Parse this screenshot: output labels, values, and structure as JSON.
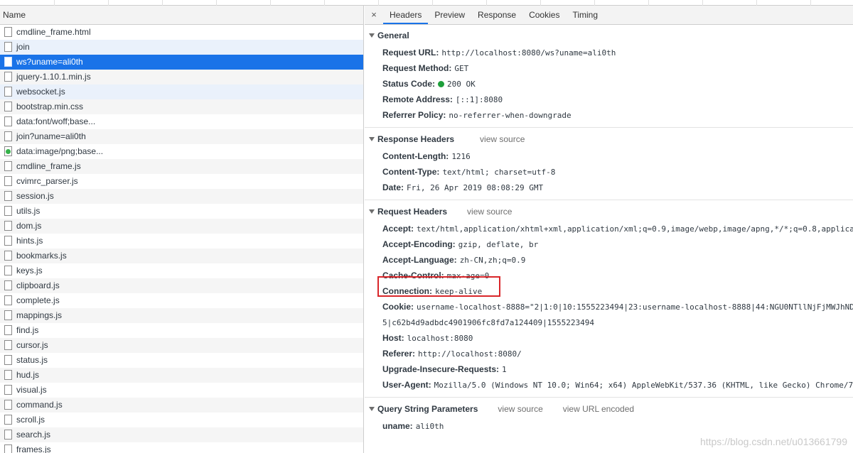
{
  "left": {
    "header": "Name",
    "rows": [
      {
        "label": "cmdline_frame.html",
        "state": "normal",
        "icon": "file-icon"
      },
      {
        "label": "join",
        "state": "hover",
        "icon": "file-icon"
      },
      {
        "label": "ws?uname=ali0th",
        "state": "selected",
        "icon": "file-icon"
      },
      {
        "label": "jquery-1.10.1.min.js",
        "state": "normal",
        "icon": "file-icon"
      },
      {
        "label": "websocket.js",
        "state": "hover",
        "icon": "file-icon"
      },
      {
        "label": "bootstrap.min.css",
        "state": "normal",
        "icon": "file-icon"
      },
      {
        "label": "data:font/woff;base...",
        "state": "normal",
        "icon": "file-icon"
      },
      {
        "label": "join?uname=ali0th",
        "state": "normal",
        "icon": "file-icon"
      },
      {
        "label": "data:image/png;base...",
        "state": "normal",
        "icon": "image-icon"
      },
      {
        "label": "cmdline_frame.js",
        "state": "normal",
        "icon": "file-icon"
      },
      {
        "label": "cvimrc_parser.js",
        "state": "normal",
        "icon": "file-icon"
      },
      {
        "label": "session.js",
        "state": "normal",
        "icon": "file-icon"
      },
      {
        "label": "utils.js",
        "state": "normal",
        "icon": "file-icon"
      },
      {
        "label": "dom.js",
        "state": "normal",
        "icon": "file-icon"
      },
      {
        "label": "hints.js",
        "state": "normal",
        "icon": "file-icon"
      },
      {
        "label": "bookmarks.js",
        "state": "normal",
        "icon": "file-icon"
      },
      {
        "label": "keys.js",
        "state": "normal",
        "icon": "file-icon"
      },
      {
        "label": "clipboard.js",
        "state": "normal",
        "icon": "file-icon"
      },
      {
        "label": "complete.js",
        "state": "normal",
        "icon": "file-icon"
      },
      {
        "label": "mappings.js",
        "state": "normal",
        "icon": "file-icon"
      },
      {
        "label": "find.js",
        "state": "normal",
        "icon": "file-icon"
      },
      {
        "label": "cursor.js",
        "state": "normal",
        "icon": "file-icon"
      },
      {
        "label": "status.js",
        "state": "normal",
        "icon": "file-icon"
      },
      {
        "label": "hud.js",
        "state": "normal",
        "icon": "file-icon"
      },
      {
        "label": "visual.js",
        "state": "normal",
        "icon": "file-icon"
      },
      {
        "label": "command.js",
        "state": "normal",
        "icon": "file-icon"
      },
      {
        "label": "scroll.js",
        "state": "normal",
        "icon": "file-icon"
      },
      {
        "label": "search.js",
        "state": "normal",
        "icon": "file-icon"
      },
      {
        "label": "frames.js",
        "state": "normal",
        "icon": "file-icon"
      }
    ]
  },
  "tabs": {
    "close": "×",
    "items": [
      "Headers",
      "Preview",
      "Response",
      "Cookies",
      "Timing"
    ],
    "active": "Headers"
  },
  "general": {
    "title": "General",
    "request_url": {
      "k": "Request URL:",
      "v": "http://localhost:8080/ws?uname=ali0th"
    },
    "request_method": {
      "k": "Request Method:",
      "v": "GET"
    },
    "status_code": {
      "k": "Status Code:",
      "v": "200 OK"
    },
    "remote_address": {
      "k": "Remote Address:",
      "v": "[::1]:8080"
    },
    "referrer_policy": {
      "k": "Referrer Policy:",
      "v": "no-referrer-when-downgrade"
    }
  },
  "response_headers": {
    "title": "Response Headers",
    "view_source": "view source",
    "items": [
      {
        "k": "Content-Length:",
        "v": "1216"
      },
      {
        "k": "Content-Type:",
        "v": "text/html; charset=utf-8"
      },
      {
        "k": "Date:",
        "v": "Fri, 26 Apr 2019 08:08:29 GMT"
      }
    ]
  },
  "request_headers": {
    "title": "Request Headers",
    "view_source": "view source",
    "accept": {
      "k": "Accept:",
      "v": "text/html,application/xhtml+xml,application/xml;q=0.9,image/webp,image/apng,*/*;q=0.8,applica"
    },
    "accept_encoding": {
      "k": "Accept-Encoding:",
      "v": "gzip, deflate, br"
    },
    "accept_language": {
      "k": "Accept-Language:",
      "v": "zh-CN,zh;q=0.9"
    },
    "cache_control": {
      "k": "Cache-Control:",
      "v": "max-age=0"
    },
    "connection": {
      "k": "Connection:",
      "v": "keep-alive"
    },
    "cookie": {
      "k": "Cookie:",
      "v": "username-localhost-8888=\"2|1:0|10:1555223494|23:username-localhost-8888|44:NGU0NTllNjFjMWJhND",
      "v2": "5|c62b4d9adbdc4901906fc8fd7a124409|1555223494"
    },
    "host": {
      "k": "Host:",
      "v": "localhost:8080"
    },
    "referer": {
      "k": "Referer:",
      "v": "http://localhost:8080/"
    },
    "upgrade": {
      "k": "Upgrade-Insecure-Requests:",
      "v": "1"
    },
    "user_agent": {
      "k": "User-Agent:",
      "v": "Mozilla/5.0 (Windows NT 10.0; Win64; x64) AppleWebKit/537.36 (KHTML, like Gecko) Chrome/7"
    }
  },
  "query_params": {
    "title": "Query String Parameters",
    "view_source": "view source",
    "view_url_encoded": "view URL encoded",
    "items": [
      {
        "k": "uname:",
        "v": "ali0th"
      }
    ]
  },
  "watermark": "https://blog.csdn.net/u013661799",
  "colors": {
    "selected": "#1a73e8",
    "status_ok": "#1e9e3a",
    "highlight_box": "#d9262a"
  }
}
